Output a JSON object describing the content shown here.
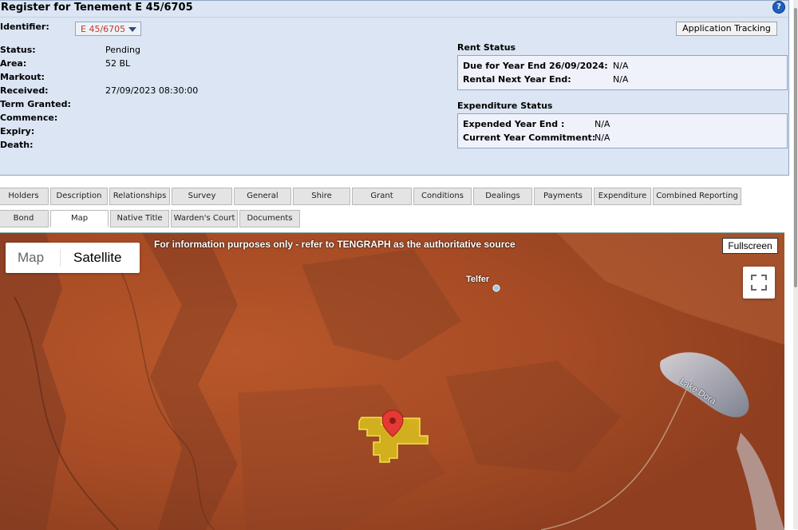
{
  "header": {
    "title": "Register for Tenement E 45/6705",
    "help_icon": "help-icon",
    "identifier_label": "Identifier:",
    "identifier_value": "E 45/6705",
    "application_tracking_label": "Application Tracking"
  },
  "details": [
    {
      "label": "Status:",
      "value": "Pending"
    },
    {
      "label": "Area:",
      "value": "52 BL"
    },
    {
      "label": "Markout:",
      "value": ""
    },
    {
      "label": "Received:",
      "value": "27/09/2023 08:30:00"
    },
    {
      "label": "Term Granted:",
      "value": ""
    },
    {
      "label": "Commence:",
      "value": ""
    },
    {
      "label": "Expiry:",
      "value": ""
    },
    {
      "label": "Death:",
      "value": ""
    }
  ],
  "rent_status": {
    "title": "Rent Status",
    "rows": [
      {
        "label": "Due for Year End 26/09/2024:",
        "value": "N/A"
      },
      {
        "label": "Rental Next Year End:",
        "value": "N/A"
      }
    ]
  },
  "expenditure_status": {
    "title": "Expenditure Status",
    "rows": [
      {
        "label": "Expended Year End :",
        "value": "N/A"
      },
      {
        "label": "Current Year Commitment:",
        "value": "N/A"
      }
    ]
  },
  "tabs_row1": [
    "Holders",
    "Description",
    "Relationships",
    "Survey",
    "General",
    "Shire",
    "Grant",
    "Conditions",
    "Dealings",
    "Payments",
    "Expenditure",
    "Combined Reporting"
  ],
  "tabs_row2": [
    "Bond",
    "Map",
    "Native Title",
    "Warden's Court",
    "Documents"
  ],
  "active_tab": "Map",
  "map": {
    "map_label": "Map",
    "satellite_label": "Satellite",
    "selected_type": "Satellite",
    "notice": "For information purposes only - refer to TENGRAPH as the authoritative source",
    "fullscreen_label": "Fullscreen",
    "place_telfer": "Telfer",
    "place_lake": "Lake Dora",
    "tenement_color": "#e3d21e",
    "marker_color": "#e53935"
  }
}
